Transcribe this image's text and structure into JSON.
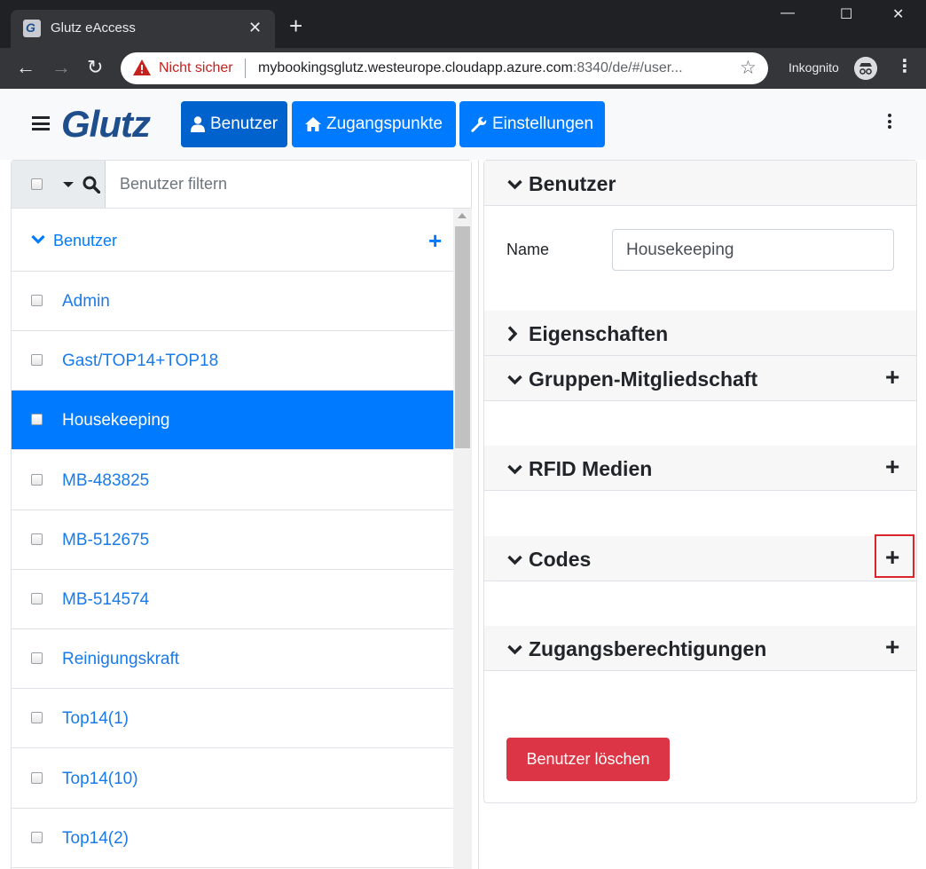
{
  "browser": {
    "tab_title": "Glutz eAccess",
    "tab_close": "✕",
    "new_tab": "+",
    "minimize": "—",
    "maximize": "☐",
    "close": "✕",
    "back": "←",
    "forward": "→",
    "reload": "↻",
    "security_warning": "Nicht sicher",
    "url_main": "mybookingsglutz.westeurope.cloudapp.azure.com",
    "url_rest": ":8340/de/#/user...",
    "star": "☆",
    "incognito_label": "Inkognito",
    "menu": "⋮"
  },
  "app": {
    "logo_text": "Glutz",
    "nav": [
      {
        "label": "Benutzer",
        "icon": "user-icon",
        "active": true
      },
      {
        "label": "Zugangspunkte",
        "icon": "home-icon",
        "active": false
      },
      {
        "label": "Einstellungen",
        "icon": "wrench-icon",
        "active": false
      }
    ]
  },
  "filter": {
    "placeholder": "Benutzer filtern"
  },
  "user_list": {
    "header_label": "Benutzer",
    "add_symbol": "+",
    "users": [
      {
        "name": "Admin",
        "selected": false
      },
      {
        "name": "Gast/TOP14+TOP18",
        "selected": false
      },
      {
        "name": "Housekeeping",
        "selected": true
      },
      {
        "name": "MB-483825",
        "selected": false
      },
      {
        "name": "MB-512675",
        "selected": false
      },
      {
        "name": "MB-514574",
        "selected": false
      },
      {
        "name": "Reinigungskraft",
        "selected": false
      },
      {
        "name": "Top14(1)",
        "selected": false
      },
      {
        "name": "Top14(10)",
        "selected": false
      },
      {
        "name": "Top14(2)",
        "selected": false
      }
    ]
  },
  "detail": {
    "sections": [
      {
        "id": "benutzer",
        "title": "Benutzer",
        "expanded": true,
        "has_add": false
      },
      {
        "id": "eigenschaften",
        "title": "Eigenschaften",
        "expanded": false,
        "has_add": false
      },
      {
        "id": "gruppen",
        "title": "Gruppen-Mitgliedschaft",
        "expanded": true,
        "has_add": true
      },
      {
        "id": "rfid",
        "title": "RFID Medien",
        "expanded": true,
        "has_add": true
      },
      {
        "id": "codes",
        "title": "Codes",
        "expanded": true,
        "has_add": true
      },
      {
        "id": "zugang",
        "title": "Zugangsberechtigungen",
        "expanded": true,
        "has_add": true
      }
    ],
    "add_symbol": "+",
    "name_label": "Name",
    "name_value": "Housekeeping",
    "delete_label": "Benutzer löschen"
  },
  "colors": {
    "primary": "#007bff",
    "primary_active": "#0062cc",
    "danger": "#dc3545",
    "logo": "#1f4e8c",
    "highlight": "#d9252b"
  }
}
